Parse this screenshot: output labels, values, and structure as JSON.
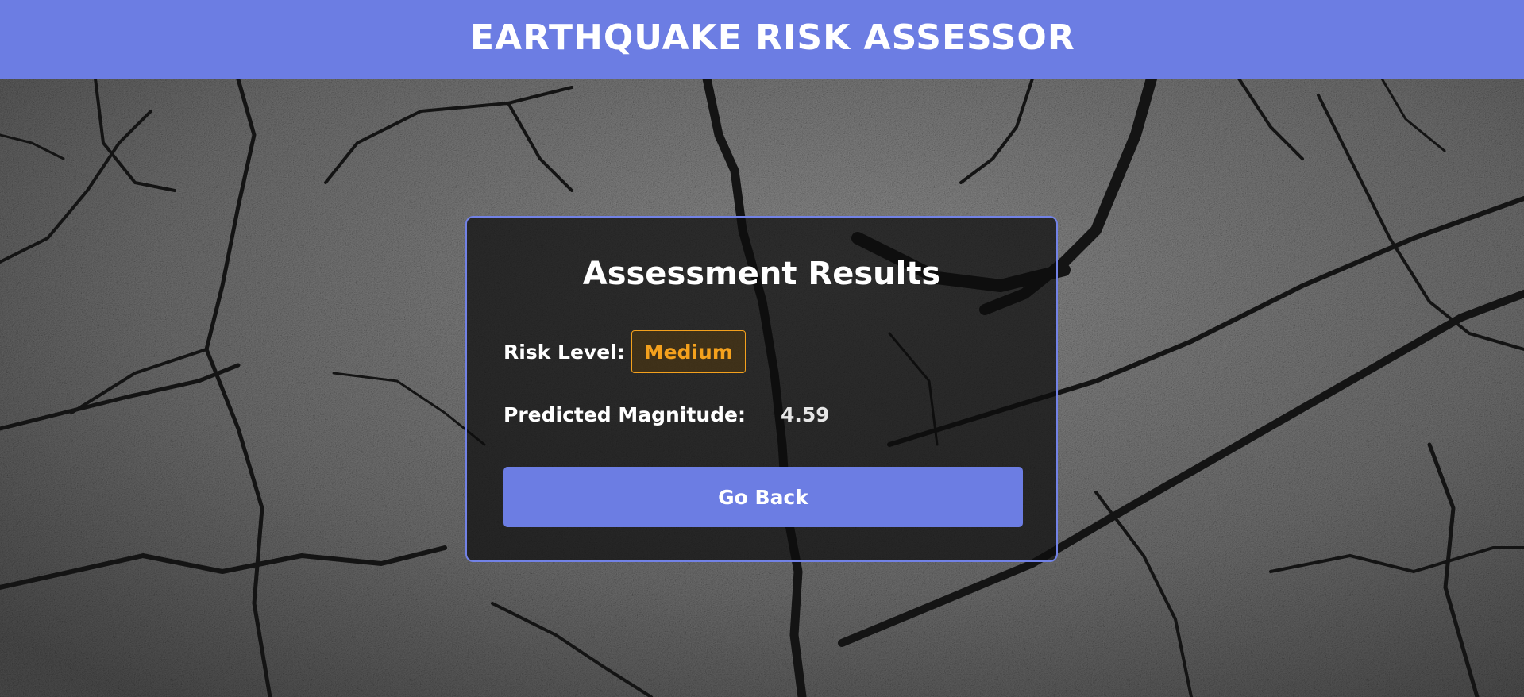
{
  "header": {
    "title": "EARTHQUAKE RISK ASSESSOR"
  },
  "results": {
    "title": "Assessment Results",
    "risk_label": "Risk Level:",
    "risk_value": "Medium",
    "magnitude_label": "Predicted Magnitude:",
    "magnitude_value": "4.59",
    "back_button_label": "Go Back"
  },
  "colors": {
    "accent": "#6c7de3",
    "risk_medium": "#f4a11d",
    "card_background": "#0c0c0c",
    "text": "#ffffff"
  },
  "background": {
    "description_icon": "cracked-ground-texture"
  }
}
